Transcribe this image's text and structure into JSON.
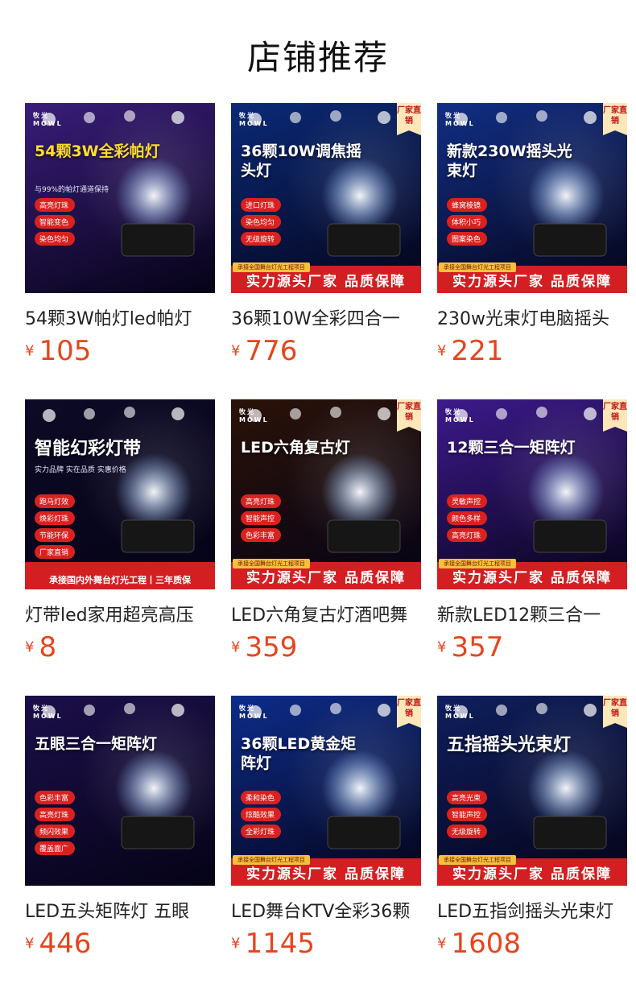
{
  "page": {
    "title": "店铺推荐"
  },
  "products": [
    {
      "name": "54颗3W帕灯led帕灯",
      "price": "105",
      "currency": "¥",
      "thumb": {
        "heading": "54颗3W全彩帕灯",
        "subtitle": "与99%的帕灯通道保持",
        "brand": "牧光",
        "brand_latin": "MOWL",
        "bullets": [
          "高亮灯珠",
          "智能变色",
          "染色均匀"
        ],
        "bg": "#3a1d7a",
        "accent": "#ffde29"
      }
    },
    {
      "name": "36颗10W全彩四合一",
      "price": "776",
      "currency": "¥",
      "thumb": {
        "heading": "36颗10W调焦摇头灯",
        "brand": "牧光",
        "brand_latin": "MOWL",
        "badge": "厂家直销",
        "bullets": [
          "进口灯珠",
          "染色均匀",
          "无级旋转"
        ],
        "banner_caption": "承接全国舞台灯光工程项目",
        "banner": "实力源头厂家 品质保障",
        "bg": "#0b2a78"
      }
    },
    {
      "name": "230w光束灯电脑摇头",
      "price": "221",
      "currency": "¥",
      "thumb": {
        "heading": "新款230W摇头光束灯",
        "brand": "牧光",
        "brand_latin": "MOWL",
        "badge": "厂家直销",
        "bullets": [
          "蜂窝棱镜",
          "体积小巧",
          "图案染色"
        ],
        "banner_caption": "承接全国舞台灯光工程项目",
        "banner": "实力源头厂家 品质保障",
        "bg": "#122f86"
      }
    },
    {
      "name": "灯带led家用超亮高压",
      "price": "8",
      "currency": "¥",
      "thumb": {
        "heading": "智能幻彩灯带",
        "subtitle": "实力品牌 实在品质 实惠价格",
        "bullets": [
          "跑马灯效",
          "焕彩灯珠",
          "节能环保",
          "厂家直销"
        ],
        "banner": "承接国内外舞台灯光工程丨三年质保",
        "bg": "#0d0a26"
      }
    },
    {
      "name": "LED六角复古灯酒吧舞",
      "price": "359",
      "currency": "¥",
      "thumb": {
        "heading": "LED六角复古灯",
        "brand": "牧光",
        "brand_latin": "MOWL",
        "badge": "厂家直销",
        "bullets": [
          "高亮灯珠",
          "智能声控",
          "色彩丰富"
        ],
        "banner_caption": "承接全国舞台灯光工程项目",
        "banner": "实力源头厂家 品质保障",
        "bg": "#2a1208"
      }
    },
    {
      "name": "新款LED12颗三合一",
      "price": "357",
      "currency": "¥",
      "thumb": {
        "heading": "12颗三合一矩阵灯",
        "brand": "牧光",
        "brand_latin": "MOWL",
        "badge": "厂家直销",
        "bullets": [
          "灵敏声控",
          "颜色多样",
          "高亮灯珠"
        ],
        "banner_caption": "承接全国舞台灯光工程项目",
        "banner": "实力源头厂家 品质保障",
        "bg": "#3d1a8c"
      }
    },
    {
      "name": "LED五头矩阵灯 五眼",
      "price": "446",
      "currency": "¥",
      "thumb": {
        "heading": "五眼三合一矩阵灯",
        "brand": "牧光",
        "brand_latin": "MOWL",
        "bullets": [
          "色彩丰富",
          "高亮灯珠",
          "频闪效果",
          "覆盖面广"
        ],
        "bg": "#1c0f4a"
      }
    },
    {
      "name": "LED舞台KTV全彩36颗",
      "price": "1145",
      "currency": "¥",
      "thumb": {
        "heading": "36颗LED黄金矩阵灯",
        "brand": "牧光",
        "brand_latin": "MOWL",
        "badge": "厂家直销",
        "bullets": [
          "柔和染色",
          "炫酷效果",
          "全彩灯珠"
        ],
        "banner_caption": "承接全国舞台灯光工程项目",
        "banner": "实力源头厂家 品质保障",
        "bg": "#0d2c8a"
      }
    },
    {
      "name": "LED五指剑摇头光束灯",
      "price": "1608",
      "currency": "¥",
      "thumb": {
        "heading": "五指摇头光束灯",
        "brand": "牧光",
        "brand_latin": "MOWL",
        "badge": "厂家直销",
        "bullets": [
          "高亮光束",
          "智能声控",
          "无级旋转"
        ],
        "banner_caption": "承接全国舞台灯光工程项目",
        "banner": "实力源头厂家 品质保障",
        "bg": "#0f1f5e"
      }
    }
  ]
}
